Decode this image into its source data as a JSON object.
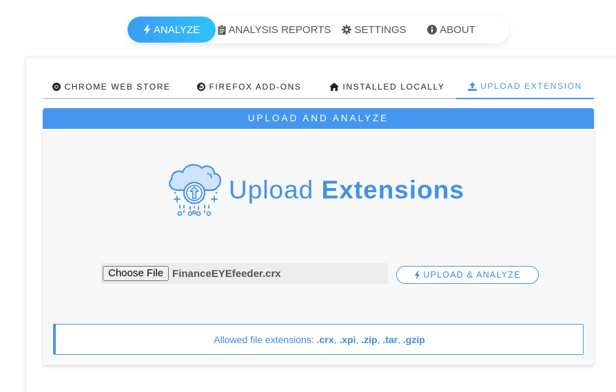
{
  "nav": {
    "items": [
      {
        "label": "ANALYZE",
        "icon": "bolt-icon",
        "active": true
      },
      {
        "label": "ANALYSIS REPORTS",
        "icon": "clipboard-icon",
        "active": false
      },
      {
        "label": "SETTINGS",
        "icon": "gear-icon",
        "active": false
      },
      {
        "label": "ABOUT",
        "icon": "info-icon",
        "active": false
      }
    ]
  },
  "tabs": [
    {
      "label": "CHROME WEB STORE",
      "icon": "chrome-icon",
      "active": false
    },
    {
      "label": "FIREFOX ADD-ONS",
      "icon": "firefox-icon",
      "active": false
    },
    {
      "label": "INSTALLED LOCALLY",
      "icon": "home-icon",
      "active": false
    },
    {
      "label": "UPLOAD EXTENSION",
      "icon": "upload-icon",
      "active": true
    }
  ],
  "upload": {
    "header": "UPLOAD AND ANALYZE",
    "title_light": "Upload",
    "title_bold": "Extensions",
    "choose_label": "Choose File",
    "file_name": "FinanceEYEfeeder.crx",
    "analyze_label": "UPLOAD & ANALYZE",
    "allowed_prefix": "Allowed file extensions: ",
    "extensions": [
      ".crx",
      ".xpi",
      ".zip",
      ".tar",
      ".gzip"
    ],
    "separator": ", "
  },
  "colors": {
    "accent": "#4496ef",
    "accent_gradient_end": "#2fc3f5",
    "text_blue": "#3f93e6"
  }
}
